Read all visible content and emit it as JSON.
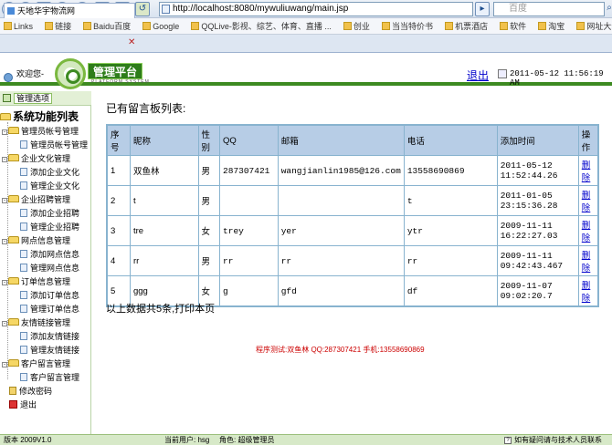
{
  "browser": {
    "url": "http://localhost:8080/mywuliuwang/main.jsp",
    "search_placeholder": "百度",
    "favorites": [
      "Links",
      "链接",
      "Baidu百度",
      "Google",
      "QQLive-影视、综艺、体育、直播 ...",
      "创业",
      "当当特价书",
      "机票酒店",
      "软件",
      "淘宝",
      "网址大全"
    ],
    "tab_title": "天地华宇物流网"
  },
  "header": {
    "welcome": "欢迎您-",
    "brand": "管理平台",
    "brand_sub": "PLATFORM SYSTEM",
    "logout": "退出",
    "datetime": "2011-05-12 11:56:19 AM"
  },
  "sidebar": {
    "title": "管理选项",
    "heading": "系统功能列表",
    "groups": [
      {
        "label": "管理员帐号管理",
        "items": [
          "管理员帐号管理"
        ]
      },
      {
        "label": "企业文化管理",
        "items": [
          "添加企业文化",
          "管理企业文化"
        ]
      },
      {
        "label": "企业招聘管理",
        "items": [
          "添加企业招聘",
          "管理企业招聘"
        ]
      },
      {
        "label": "网点信息管理",
        "items": [
          "添加网点信息",
          "管理网点信息"
        ]
      },
      {
        "label": "订单信息管理",
        "items": [
          "添加订单信息",
          "管理订单信息"
        ]
      },
      {
        "label": "友情链接管理",
        "items": [
          "添加友情链接",
          "管理友情链接"
        ]
      },
      {
        "label": "客户留言管理",
        "items": [
          "客户留言管理"
        ]
      }
    ],
    "change_password": "修改密码",
    "exit": "退出"
  },
  "main": {
    "title": "已有留言板列表:",
    "columns": [
      "序号",
      "昵称",
      "性别",
      "QQ",
      "邮箱",
      "电话",
      "添加时间",
      "操作"
    ],
    "rows": [
      {
        "id": "1",
        "nickname": "双鱼林",
        "gender": "男",
        "qq": "287307421",
        "email": "wangjianlin1985@126.com",
        "phone": "13558690869",
        "time_date": "2011-05-12",
        "time_clock": "11:52:44.26",
        "action": "删除"
      },
      {
        "id": "2",
        "nickname": "t",
        "gender": "男",
        "qq": "",
        "email": "",
        "phone": "t",
        "time_date": "2011-01-05",
        "time_clock": "23:15:36.28",
        "action": "删除"
      },
      {
        "id": "3",
        "nickname": "tre",
        "gender": "女",
        "qq": "trey",
        "email": "yer",
        "phone": "ytr",
        "time_date": "2009-11-11",
        "time_clock": "16:22:27.03",
        "action": "删除"
      },
      {
        "id": "4",
        "nickname": "rr",
        "gender": "男",
        "qq": "rr",
        "email": "rr",
        "phone": "rr",
        "time_date": "2009-11-11",
        "time_clock": "09:42:43.467",
        "action": "删除"
      },
      {
        "id": "5",
        "nickname": "ggg",
        "gender": "女",
        "qq": "g",
        "email": "gfd",
        "phone": "df",
        "time_date": "2009-11-07",
        "time_clock": "09:02:20.7",
        "action": "删除"
      }
    ],
    "summary": "以上数据共5条,打印本页",
    "tester": "程序测试:双鱼林 QQ:287307421 手机:13558690869"
  },
  "statusbar": {
    "version": "版本 2009V1.0",
    "current_user": "当前用户: hsg",
    "role": "角色: 超级管理员",
    "help": "如有疑问请与技术人员联系"
  }
}
